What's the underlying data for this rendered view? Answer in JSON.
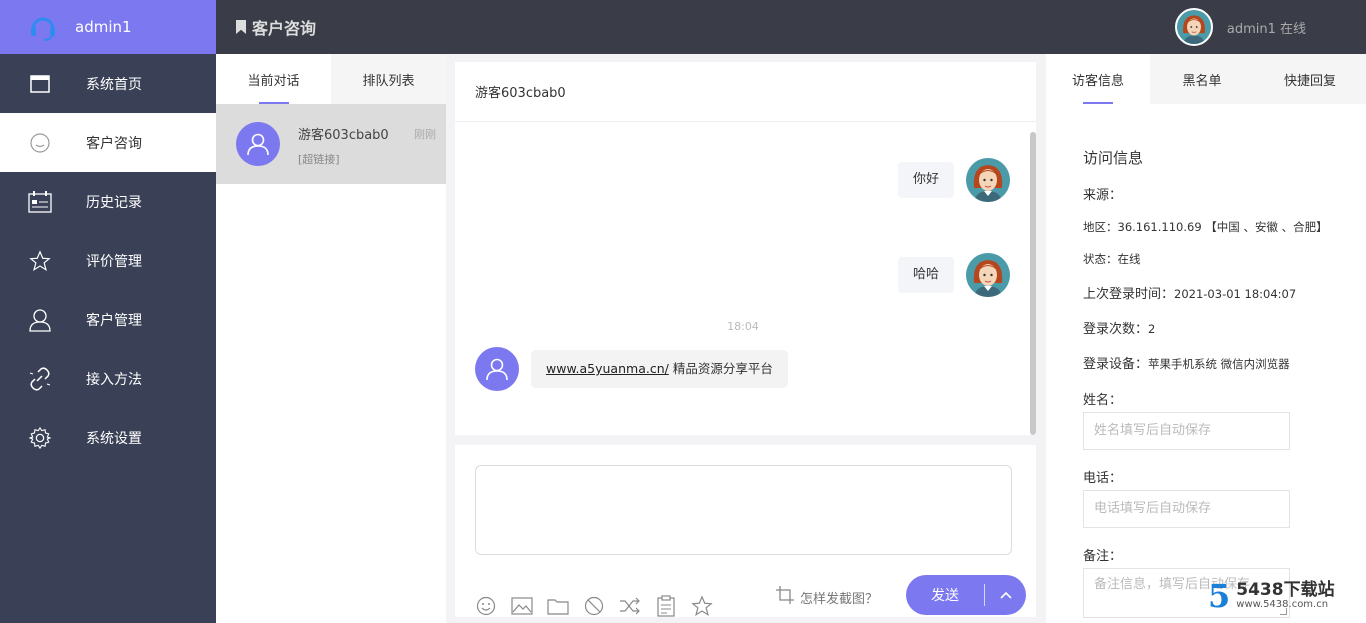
{
  "sidebar": {
    "user": "admin1",
    "items": [
      {
        "label": "系统首页",
        "icon": "window-icon"
      },
      {
        "label": "客户咨询",
        "icon": "chat-bubble-icon"
      },
      {
        "label": "历史记录",
        "icon": "calendar-icon"
      },
      {
        "label": "评价管理",
        "icon": "star-icon"
      },
      {
        "label": "客户管理",
        "icon": "user-icon"
      },
      {
        "label": "接入方法",
        "icon": "link-icon"
      },
      {
        "label": "系统设置",
        "icon": "gear-icon"
      }
    ]
  },
  "topbar": {
    "title": "客户咨询",
    "user_status": "admin1 在线"
  },
  "convlist": {
    "tabs": [
      "当前对话",
      "排队列表"
    ],
    "items": [
      {
        "name": "游客603cbab0",
        "sub": "[超链接]",
        "time": "刚刚"
      }
    ]
  },
  "chat": {
    "header": "游客603cbab0",
    "messages_right": [
      "你好",
      "哈哈"
    ],
    "time": "18:04",
    "message_left": {
      "link": "www.a5yuanma.cn/",
      "text": "精品资源分享平台"
    }
  },
  "composer": {
    "tools": [
      "emoji-icon",
      "image-icon",
      "folder-icon",
      "block-icon",
      "shuffle-icon",
      "clipboard-icon",
      "star-icon"
    ],
    "howto": "怎样发截图？",
    "send": "发送"
  },
  "rpanel": {
    "tabs": [
      "访客信息",
      "黑名单",
      "快捷回复"
    ],
    "title": "访问信息",
    "rows": [
      {
        "label": "来源：",
        "value": ""
      },
      {
        "label": "地区：",
        "value": "36.161.110.69 【中国 、安徽 、合肥】"
      },
      {
        "label": "状态：",
        "value": "在线"
      },
      {
        "label": "上次登录时间：",
        "value": "2021-03-01 18:04:07"
      },
      {
        "label": "登录次数：",
        "value": "2"
      },
      {
        "label": "登录设备：",
        "value": "苹果手机系统 微信内浏览器"
      }
    ],
    "name_label": "姓名：",
    "name_placeholder": "姓名填写后自动保存",
    "phone_label": "电话：",
    "phone_placeholder": "电话填写后自动保存",
    "note_label": "备注：",
    "note_placeholder": "备注信息，填写后自动保存"
  },
  "watermark": {
    "brand": "5438下载站",
    "url": "www.5438.com.cn"
  },
  "colors": {
    "accent": "#7b78f0",
    "sidebar": "#3a4156",
    "topbar": "#3a3d48"
  }
}
